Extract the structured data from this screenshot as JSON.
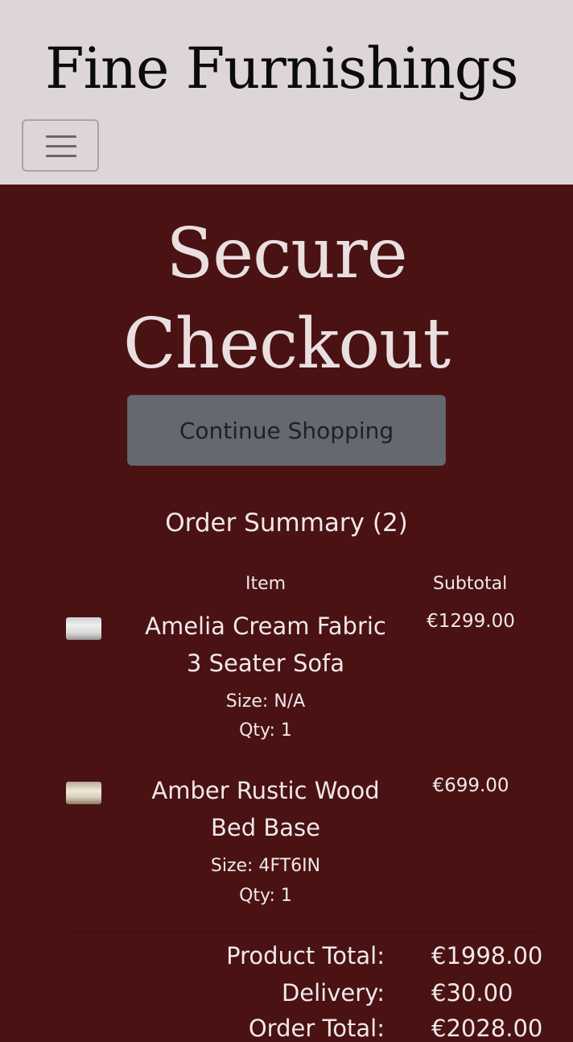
{
  "header": {
    "brand": "Fine Furnishings",
    "menu_icon": "hamburger-menu-icon"
  },
  "main": {
    "title": "Secure Checkout",
    "continue_label": "Continue Shopping",
    "summary_title": "Order Summary (2)",
    "columns": {
      "item": "Item",
      "subtotal": "Subtotal"
    },
    "items": [
      {
        "name": "Amelia Cream Fabric 3 Seater Sofa",
        "size": "Size: N/A",
        "qty": "Qty: 1",
        "subtotal": "€1299.00"
      },
      {
        "name": "Amber Rustic Wood Bed Base",
        "size": "Size: 4FT6IN",
        "qty": "Qty: 1",
        "subtotal": "€699.00"
      }
    ],
    "totals": {
      "product_total_label": "Product Total:",
      "product_total": "€1998.00",
      "delivery_label": "Delivery:",
      "delivery": "€30.00",
      "order_total_label": "Order Total:",
      "order_total": "€2028.00"
    }
  },
  "colors": {
    "header_bg": "#ddd5d6",
    "main_bg": "#4a1213",
    "button_bg": "#666870",
    "text_light": "#f0e8e9"
  }
}
